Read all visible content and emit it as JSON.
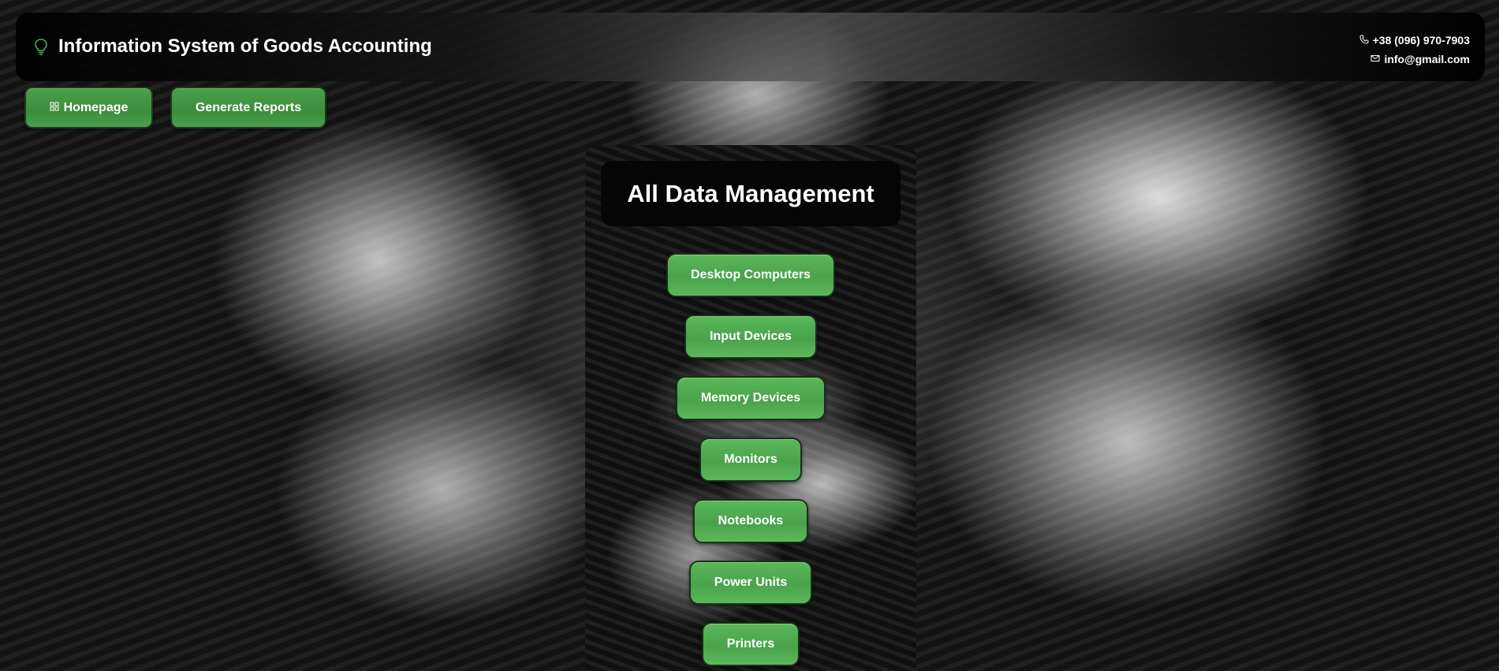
{
  "header": {
    "title": "Information System of Goods Accounting",
    "logo_icon": "lightbulb-icon",
    "phone": "+38 (096) 970-7903",
    "phone_icon": "phone-icon",
    "email": "info@gmail.com",
    "email_icon": "envelope-icon"
  },
  "nav": {
    "home_label": "Homepage",
    "home_icon": "grid-icon",
    "reports_label": "Generate Reports"
  },
  "panel": {
    "title": "All Data Management",
    "categories": [
      "Desktop Computers",
      "Input Devices",
      "Memory Devices",
      "Monitors",
      "Notebooks",
      "Power Units",
      "Printers"
    ]
  },
  "colors": {
    "accent_green": "#4aa24a",
    "icon_green": "#4caf50",
    "text": "#ffffff"
  }
}
